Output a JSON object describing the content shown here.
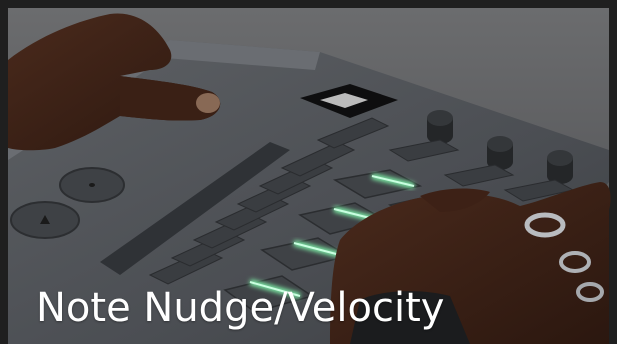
{
  "caption": "Note Nudge/Velocity",
  "colors": {
    "background": "#1e1e1e",
    "device_body": "#4f5257",
    "pad_glow": "#7ef0a8",
    "caption_text": "#ffffff"
  }
}
